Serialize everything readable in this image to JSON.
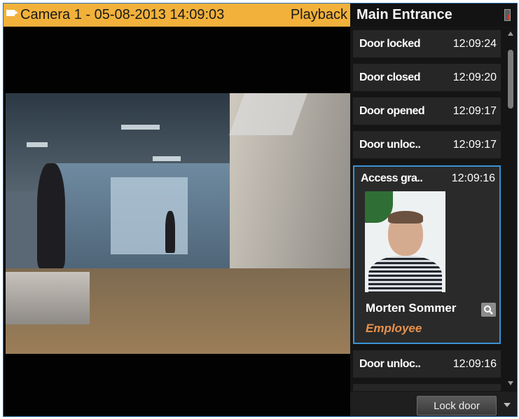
{
  "camera": {
    "title": "Camera 1 - 05-08-2013 14:09:03",
    "mode": "Playback",
    "header_color": "#f2b13b"
  },
  "panel": {
    "title": "Main Entrance",
    "header_icon": "door-status-icon"
  },
  "events": [
    {
      "title": "Door locked",
      "time": "12:09:24"
    },
    {
      "title": "Door closed",
      "time": "12:09:20"
    },
    {
      "title": "Door opened",
      "time": "12:09:17"
    },
    {
      "title": "Door unloc..",
      "time": "12:09:17"
    },
    {
      "title": "Access gra..",
      "time": "12:09:16",
      "selected": true,
      "person_name": "Morten Sommer",
      "person_role": "Employee"
    },
    {
      "title": "Door unloc..",
      "time": "12:09:16"
    }
  ],
  "footer": {
    "lock_button": "Lock door"
  },
  "colors": {
    "selected_border": "#3a93d4",
    "role_text": "#e8914b"
  }
}
